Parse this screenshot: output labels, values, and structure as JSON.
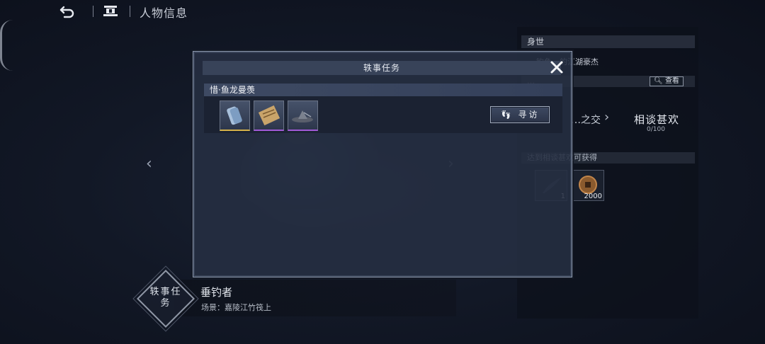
{
  "topbar": {
    "back_icon": "undo-arrow-icon",
    "home_icon": "house-icon",
    "title": "人物信息"
  },
  "right_panel": {
    "section_title": "身世",
    "identity_text": "…钓鱼…的江湖豪杰",
    "sub_header": "…",
    "view_button": "查看",
    "relation_prev": "…之交",
    "relation_current": "相谈甚欢",
    "relation_progress": "0/100",
    "reward_header": "达到相谈甚欢可获得",
    "rewards": [
      {
        "icon": "feather-icon",
        "count": "1"
      },
      {
        "icon": "copper-coin-icon",
        "count": "2000"
      }
    ]
  },
  "npc": {
    "badge": "轶事任务",
    "name": "垂钓者",
    "scene": "场景：嘉陵江竹筏上"
  },
  "modal": {
    "title": "轶事任务",
    "task_name": "惜·鱼龙曼羡",
    "items": [
      {
        "icon": "scroll-bundle-icon",
        "rarity": "gold"
      },
      {
        "icon": "unrolled-scroll-icon",
        "rarity": "purple"
      },
      {
        "icon": "hat-icon",
        "rarity": "purple"
      }
    ],
    "visit_button": "寻访",
    "visit_icon": "footprints-icon"
  },
  "colors": {
    "gold_rarity": "#d6b24a",
    "purple_rarity": "#a25ad8",
    "modal_bg": "#262f42"
  }
}
